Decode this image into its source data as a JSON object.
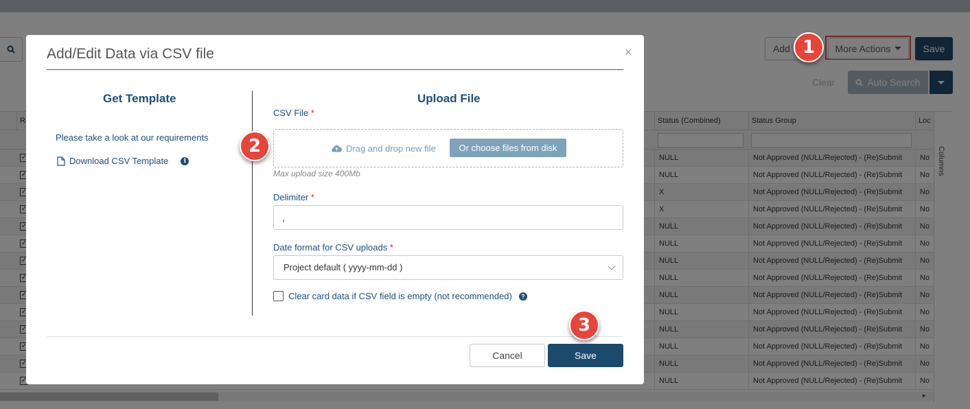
{
  "background": {
    "buttons": {
      "add": "Add",
      "more_actions": "More Actions",
      "save": "Save",
      "clear": "Clear",
      "auto_search": "Auto Search"
    },
    "grid": {
      "headers": [
        "Re",
        "Status (Combined)",
        "Status Group",
        "Loc"
      ],
      "rows": [
        {
          "status": "NULL",
          "group": "Not Approved (NULL/Rejected) - (Re)Submit",
          "loc": "No"
        },
        {
          "status": "NULL",
          "group": "Not Approved (NULL/Rejected) - (Re)Submit",
          "loc": "No"
        },
        {
          "status": "X",
          "group": "Not Approved (NULL/Rejected) - (Re)Submit",
          "loc": "No"
        },
        {
          "status": "X",
          "group": "Not Approved (NULL/Rejected) - (Re)Submit",
          "loc": "No"
        },
        {
          "status": "NULL",
          "group": "Not Approved (NULL/Rejected) - (Re)Submit",
          "loc": "No"
        },
        {
          "status": "NULL",
          "group": "Not Approved (NULL/Rejected) - (Re)Submit",
          "loc": "No"
        },
        {
          "status": "NULL",
          "group": "Not Approved (NULL/Rejected) - (Re)Submit",
          "loc": "No"
        },
        {
          "status": "NULL",
          "group": "Not Approved (NULL/Rejected) - (Re)Submit",
          "loc": "No"
        },
        {
          "status": "NULL",
          "group": "Not Approved (NULL/Rejected) - (Re)Submit",
          "loc": "No"
        },
        {
          "status": "NULL",
          "group": "Not Approved (NULL/Rejected) - (Re)Submit",
          "loc": "No"
        },
        {
          "status": "NULL",
          "group": "Not Approved (NULL/Rejected) - (Re)Submit",
          "loc": "No"
        },
        {
          "status": "NULL",
          "group": "Not Approved (NULL/Rejected) - (Re)Submit",
          "loc": "No"
        },
        {
          "status": "NULL",
          "group": "Not Approved (NULL/Rejected) - (Re)Submit",
          "loc": "No"
        },
        {
          "status": "NULL",
          "group": "Not Approved (NULL/Rejected) - (Re)Submit",
          "loc": "No"
        }
      ],
      "columns_panel": "Columns"
    }
  },
  "modal": {
    "title": "Add/Edit Data via CSV file",
    "left": {
      "title": "Get Template",
      "requirements_text": "Please take a look at our requirements",
      "download_link": "Download CSV Template"
    },
    "right": {
      "title": "Upload File",
      "csv_label": "CSV File",
      "dropzone_text": "Drag and drop new file",
      "choose_button": "Or choose files from disk",
      "max_upload": "Max upload size 400Mb",
      "delimiter_label": "Delimiter",
      "delimiter_value": ",",
      "date_format_label": "Date format for CSV uploads",
      "date_format_value": "Project default ( yyyy-mm-dd )",
      "clear_checkbox_label": "Clear card data if CSV field is empty (not recommended)",
      "clear_checked": false
    },
    "footer": {
      "cancel": "Cancel",
      "save": "Save"
    }
  },
  "steps": [
    "1",
    "2",
    "3"
  ],
  "colors": {
    "primary": "#1c4a6d",
    "badge": "#e8443a",
    "link": "#1f4e79",
    "required": "#e0262c"
  }
}
